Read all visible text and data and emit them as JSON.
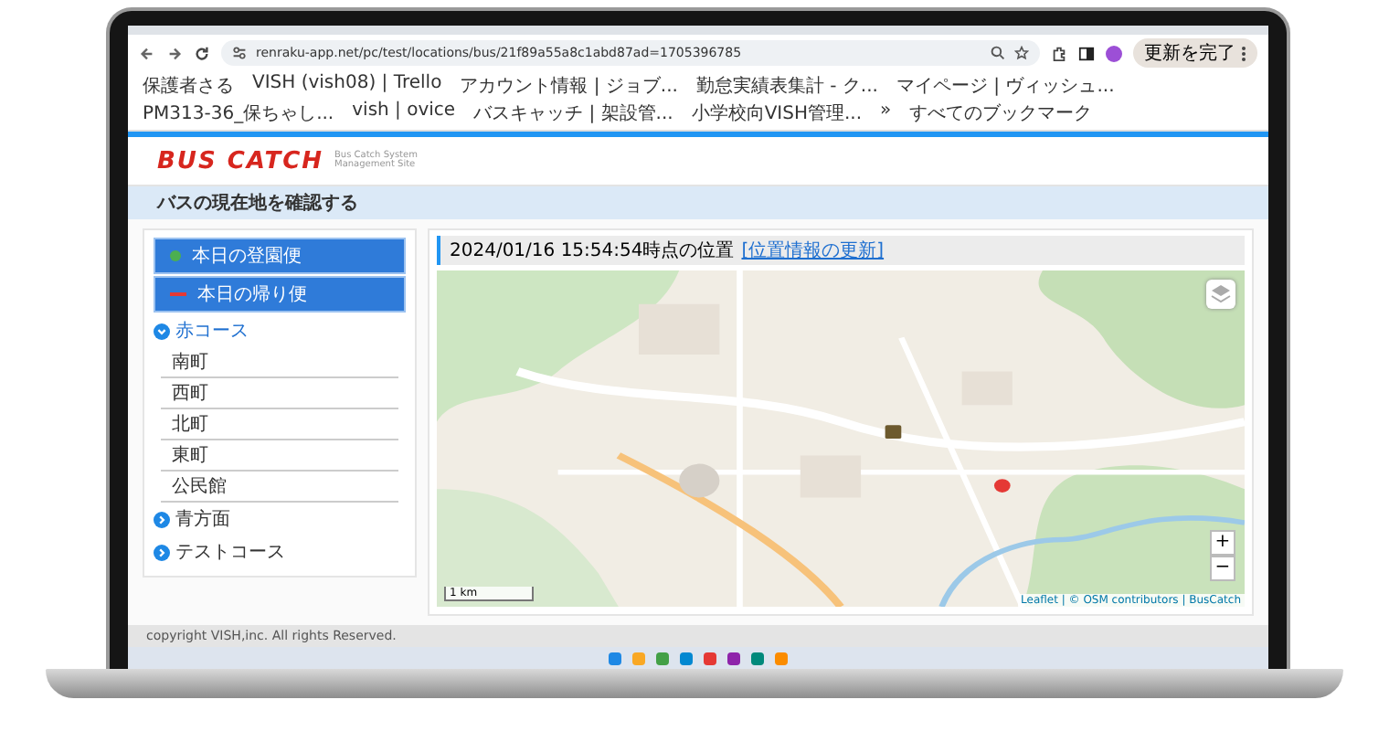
{
  "browser": {
    "url": "renraku-app.net/pc/test/locations/bus/21f89a55a8c1abd87ad=1705396785",
    "update_button": "更新を完了",
    "bookmarks": [
      {
        "label": "保護者さる"
      },
      {
        "label": "VISH (vish08) | Trello"
      },
      {
        "label": "アカウント情報 | ジョブ..."
      },
      {
        "label": "勤怠実績表集計 - ク..."
      },
      {
        "label": "マイページ | ヴィッシュ..."
      },
      {
        "label": "PM313-36_保ちゃし..."
      },
      {
        "label": "vish | ovice"
      },
      {
        "label": "バスキャッチ | 架設管..."
      },
      {
        "label": "小学校向VISH管理..."
      },
      {
        "label": "»"
      },
      {
        "label": "すべてのブックマーク"
      }
    ]
  },
  "site": {
    "logo": "BUS CATCH",
    "logo_subtitle": "Bus Catch System Management Site",
    "page_title": "バスの現在地を確認する"
  },
  "sidebar": {
    "route_buttons": [
      {
        "label": "本日の登園便",
        "kind": "dot",
        "color": "#4caf50"
      },
      {
        "label": "本日の帰り便",
        "kind": "line",
        "color": "#e53935"
      }
    ],
    "courses": [
      {
        "label": "赤コース",
        "expanded": true,
        "children": [
          {
            "label": "南町"
          },
          {
            "label": "西町"
          },
          {
            "label": "北町"
          },
          {
            "label": "東町"
          },
          {
            "label": "公民館"
          }
        ]
      },
      {
        "label": "青方面",
        "expanded": false
      },
      {
        "label": "テストコース",
        "expanded": false
      }
    ]
  },
  "map_panel": {
    "timestamp": "2024/01/16 15:54:54時点の位置",
    "refresh_link": "[位置情報の更新]",
    "zoom_in": "+",
    "zoom_out": "−",
    "scale": "1 km",
    "attribution": "Leaflet | © OSM contributors | BusCatch"
  },
  "footer": "copyright VISH,inc. All rights Reserved."
}
